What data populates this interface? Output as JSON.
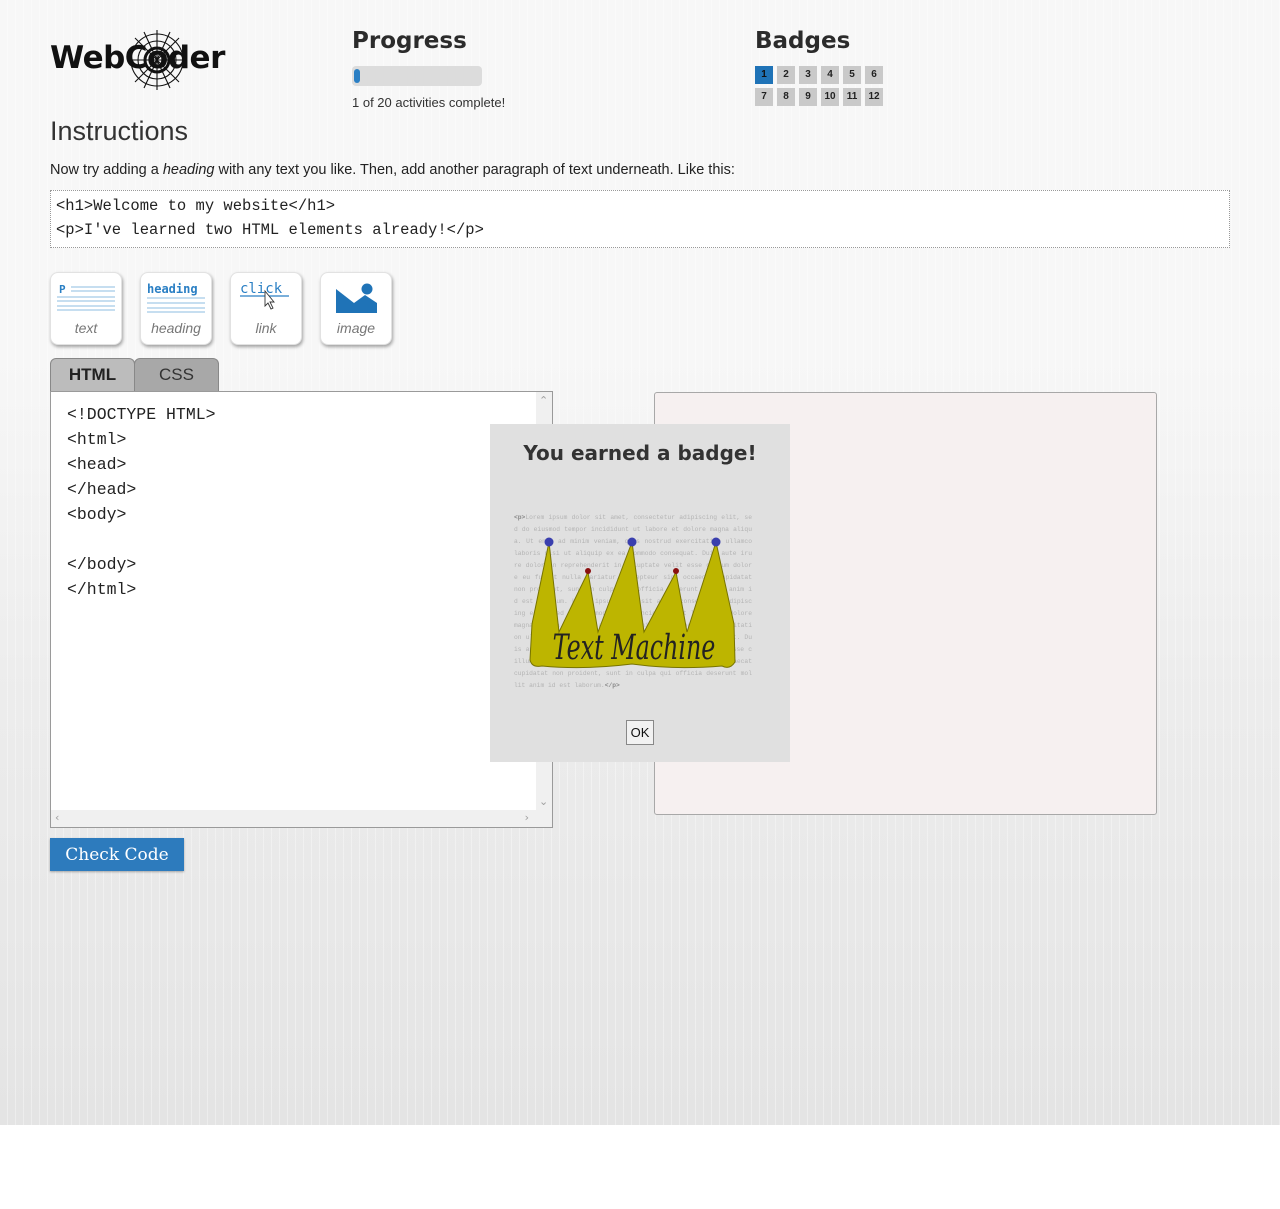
{
  "logo": {
    "text": "WebCoder"
  },
  "progress": {
    "title": "Progress",
    "fraction": 0.05,
    "text": "1 of 20 activities complete!"
  },
  "badges": {
    "title": "Badges",
    "items": [
      {
        "label": "1",
        "earned": true
      },
      {
        "label": "2",
        "earned": false
      },
      {
        "label": "3",
        "earned": false
      },
      {
        "label": "4",
        "earned": false
      },
      {
        "label": "5",
        "earned": false
      },
      {
        "label": "6",
        "earned": false
      },
      {
        "label": "7",
        "earned": false
      },
      {
        "label": "8",
        "earned": false
      },
      {
        "label": "9",
        "earned": false
      },
      {
        "label": "10",
        "earned": false
      },
      {
        "label": "11",
        "earned": false
      },
      {
        "label": "12",
        "earned": false
      }
    ]
  },
  "instructions": {
    "title": "Instructions",
    "text_before": "Now try adding a ",
    "text_em": "heading",
    "text_after": " with any text you like. Then, add another paragraph of text underneath. Like this:",
    "example_lines": [
      "<h1>Welcome to my website</h1>",
      "<p>I've learned two HTML elements already!</p>"
    ]
  },
  "tools": [
    {
      "name": "text",
      "label": "text",
      "icon": "paragraph-icon",
      "icon_text": "P"
    },
    {
      "name": "heading",
      "label": "heading",
      "icon": "heading-icon",
      "icon_text": "heading"
    },
    {
      "name": "link",
      "label": "link",
      "icon": "link-icon",
      "icon_text": "click"
    },
    {
      "name": "image",
      "label": "image",
      "icon": "image-icon"
    }
  ],
  "tabs": {
    "html": "HTML",
    "css": "CSS",
    "active": "HTML"
  },
  "editor": {
    "code": "<!DOCTYPE HTML>\n<html>\n<head>\n</head>\n<body>\n\n</body>\n</html>"
  },
  "check_code_label": "Check Code",
  "dialog": {
    "title": "You earned a badge!",
    "badge_name": "Text Machine",
    "badge_background_text": "Lorem ipsum dolor sit amet, consectetur adipiscing elit, sed do eiusmod tempor incididunt ut labore et dolore magna aliqua. Ut enim ad minim veniam, quis nostrud exercitation ullamco laboris nisi ut aliquip ex ea commodo consequat. Duis aute irure dolor in reprehenderit in voluptate velit esse cillum dolore eu fugiat nulla pariatur. Excepteur sint occaecat cupidatat non proident, sunt in culpa qui officia deserunt mollit anim id est laborum. Lorem ipsum dolor sit amet, consectetur adipiscing elit, sed do eiusmod tempor incididunt ut labore et dolore magna aliqua. Ut enim ad minim veniam, quis nostrud exercitation ullamco laboris nisi ut aliquip ex ea commodo consequat. Duis aute irure dolor in reprehenderit in voluptate velit esse cillum dolore eu fugiat nulla pariatur. Excepteur sint occaecat cupidatat non proident, sunt in culpa qui officia deserunt mollit anim id est laborum.",
    "badge_background_open_tag": "<p>",
    "badge_background_close_tag": "</p>",
    "ok_label": "OK"
  },
  "colors": {
    "accent": "#2a7fc4",
    "button": "#2d7bbd",
    "crown": "#bdb500",
    "badge_earned": "#1f73b7"
  }
}
